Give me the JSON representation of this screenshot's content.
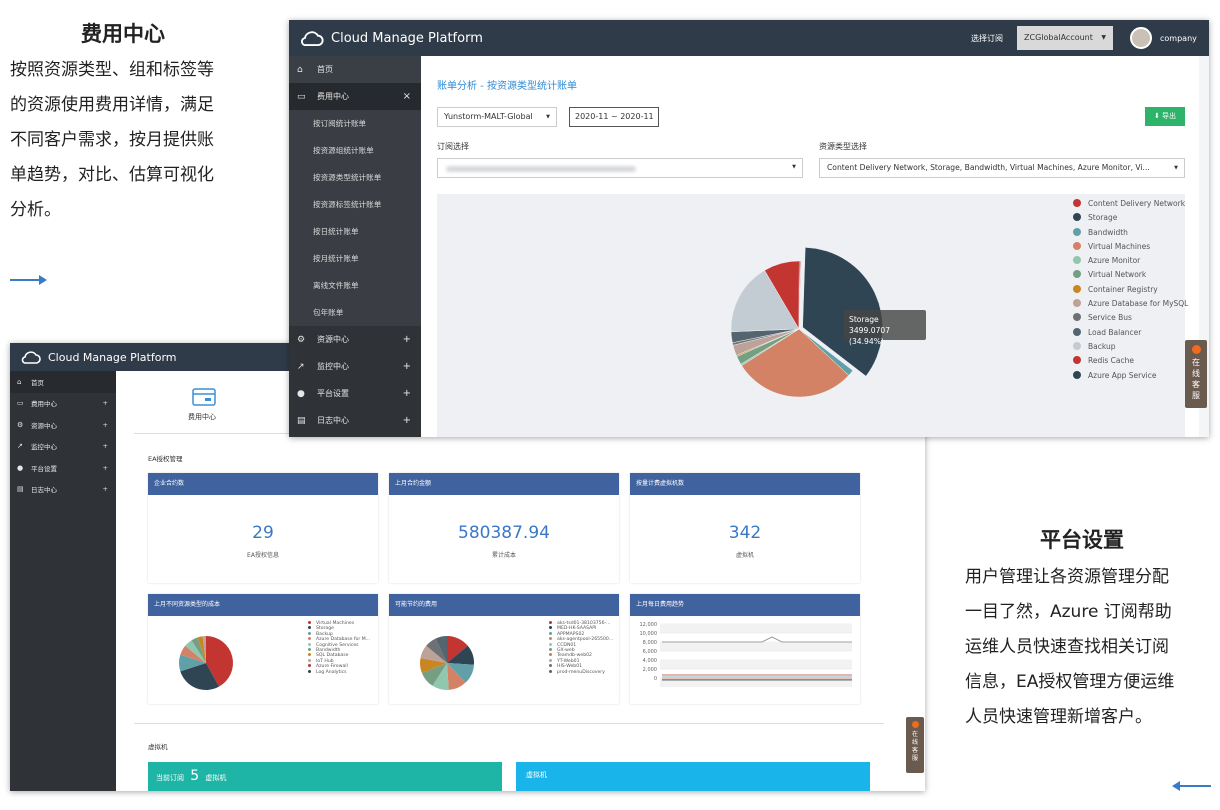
{
  "left_annotation": {
    "title": "费用中心",
    "lines": [
      "按照资源类型、组和标签等",
      "的资源使用费用详情，满足",
      "不同客户需求，按月提供账",
      "单趋势，对比、估算可视化",
      "分析。"
    ]
  },
  "right_annotation": {
    "title": "平台设置",
    "lines": [
      "用户管理让各资源管理分配",
      "一目了然，Azure 订阅帮助",
      "运维人员快速查找相关订阅",
      "信息，EA授权管理方便运维",
      "人员快速管理新增客户。"
    ]
  },
  "back_window": {
    "title": "Cloud Manage Platform",
    "sidebar": [
      {
        "icon": "home-icon",
        "label": "首页",
        "plus": ""
      },
      {
        "icon": "card-icon",
        "label": "费用中心",
        "plus": "+"
      },
      {
        "icon": "gears-icon",
        "label": "资源中心",
        "plus": "+"
      },
      {
        "icon": "chart-icon",
        "label": "监控中心",
        "plus": "+"
      },
      {
        "icon": "user-icon",
        "label": "平台设置",
        "plus": "+"
      },
      {
        "icon": "log-icon",
        "label": "日志中心",
        "plus": "+"
      }
    ],
    "top_icon_label": "费用中心",
    "ea_section": "EA授权管理",
    "stats": [
      {
        "header": "企业合约数",
        "value": "29",
        "label": "EA授权信息"
      },
      {
        "header": "上月合约金额",
        "value": "580387.94",
        "label": "累计成本"
      },
      {
        "header": "按量计费虚拟机数",
        "value": "342",
        "label": "虚拟机"
      }
    ],
    "chart_cards": [
      "上月不同资源类型的成本",
      "可能节约的费用",
      "上月每日费用趋势"
    ],
    "legend1": [
      "Virtual Machines",
      "Storage",
      "Backup",
      "Azure Database for M...",
      "Cognitive Services",
      "Bandwidth",
      "SQL Database",
      "IoT Hub",
      "Azure Firewall",
      "Log Analytics"
    ],
    "legend2": [
      "aks-tsd01-38103756-...",
      "MED-HK-SAASAPI",
      "APPMAPS02",
      "aks-agentpool-265500...",
      "CCDN01",
      "GX-web",
      "Teamdb-web02",
      "YT-Web01",
      "HIS-Web01",
      "prod-menuDiscovery"
    ],
    "line_y_ticks": [
      "12,000",
      "10,000",
      "8,000",
      "6,000",
      "4,000",
      "2,000",
      "0"
    ],
    "vm_section": "虚拟机",
    "vm_bar1": {
      "prefix": "当前订阅",
      "count": "5",
      "suffix": "虚拟机"
    },
    "vm_bar2": "虚拟机",
    "service_tab": "在线客服"
  },
  "front_window": {
    "title": "Cloud Manage Platform",
    "select_sub_label": "选择订阅",
    "account": "ZCGlobalAccount",
    "user": "company",
    "sidebar": [
      {
        "type": "main",
        "icon": "home-icon",
        "label": "首页",
        "mark": ""
      },
      {
        "type": "main",
        "icon": "card-icon",
        "label": "费用中心",
        "mark": "×"
      },
      {
        "type": "sub",
        "label": "按订阅统计账单"
      },
      {
        "type": "sub",
        "label": "按资源组统计账单"
      },
      {
        "type": "sub",
        "label": "按资源类型统计账单"
      },
      {
        "type": "sub",
        "label": "按资源标签统计账单"
      },
      {
        "type": "sub",
        "label": "按日统计账单"
      },
      {
        "type": "sub",
        "label": "按月统计账单"
      },
      {
        "type": "sub",
        "label": "离线文件账单"
      },
      {
        "type": "sub",
        "label": "包年账单"
      },
      {
        "type": "main",
        "icon": "gears-icon",
        "label": "资源中心",
        "mark": "+"
      },
      {
        "type": "main",
        "icon": "chart-icon",
        "label": "监控中心",
        "mark": "+"
      },
      {
        "type": "main",
        "icon": "user-icon",
        "label": "平台设置",
        "mark": "+"
      },
      {
        "type": "main",
        "icon": "log-icon",
        "label": "日志中心",
        "mark": "+"
      }
    ],
    "page_title": "账单分析 - 按资源类型统计账单",
    "region_select": "Yunstorm-MALT-Global",
    "date_range": "2020-11 ~ 2020-11",
    "export_label": "导出",
    "subscription_label": "订阅选择",
    "resource_type_label": "资源类型选择",
    "resource_type_value": "Content Delivery Network, Storage, Bandwidth, Virtual Machines, Azure Monitor, Vi...",
    "tooltip_name": "Storage",
    "tooltip_value": "3499.0707 (34.94%)",
    "service_tab": "在线客服"
  },
  "chart_data": {
    "type": "pie",
    "categories": [
      "Content Delivery Network",
      "Storage",
      "Bandwidth",
      "Virtual Machines",
      "Azure Monitor",
      "Virtual Network",
      "Container Registry",
      "Azure Database for MySQL",
      "Service Bus",
      "Load Balancer",
      "Backup",
      "Redis Cache",
      "Azure App Service"
    ],
    "values": [
      0.2,
      34.94,
      1.5,
      29.0,
      0.4,
      2.0,
      0.3,
      2.5,
      0.6,
      2.6,
      17.2,
      8.5,
      0.26
    ],
    "unit": "percent of total",
    "colors": [
      "#c23531",
      "#2f4554",
      "#61a0a8",
      "#d48265",
      "#91c7ae",
      "#749f83",
      "#ca8622",
      "#bda29a",
      "#6e7074",
      "#546570",
      "#c4ccd3",
      "#c23531",
      "#2f4554"
    ],
    "legend_position": "right"
  }
}
